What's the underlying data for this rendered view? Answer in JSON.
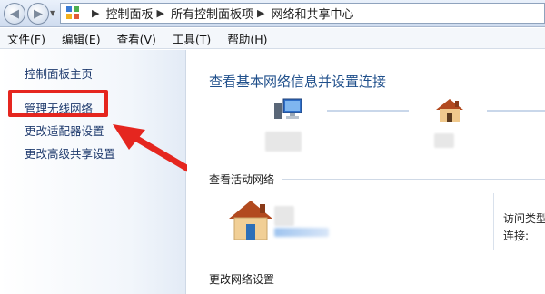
{
  "breadcrumb": [
    "控制面板",
    "所有控制面板项",
    "网络和共享中心"
  ],
  "menu": [
    "文件(F)",
    "编辑(E)",
    "查看(V)",
    "工具(T)",
    "帮助(H)"
  ],
  "sidebar": {
    "home": "控制面板主页",
    "wireless": "管理无线网络",
    "adapter": "更改适配器设置",
    "sharing": "更改高级共享设置"
  },
  "main": {
    "title": "查看基本网络信息并设置连接",
    "active_networks": "查看活动网络",
    "change_settings": "更改网络设置",
    "access_type_label": "访问类型",
    "connection_label": "连接:"
  },
  "colors": {
    "highlight": "#e5261f",
    "link": "#1f3b6e",
    "title": "#1f4f8b"
  }
}
